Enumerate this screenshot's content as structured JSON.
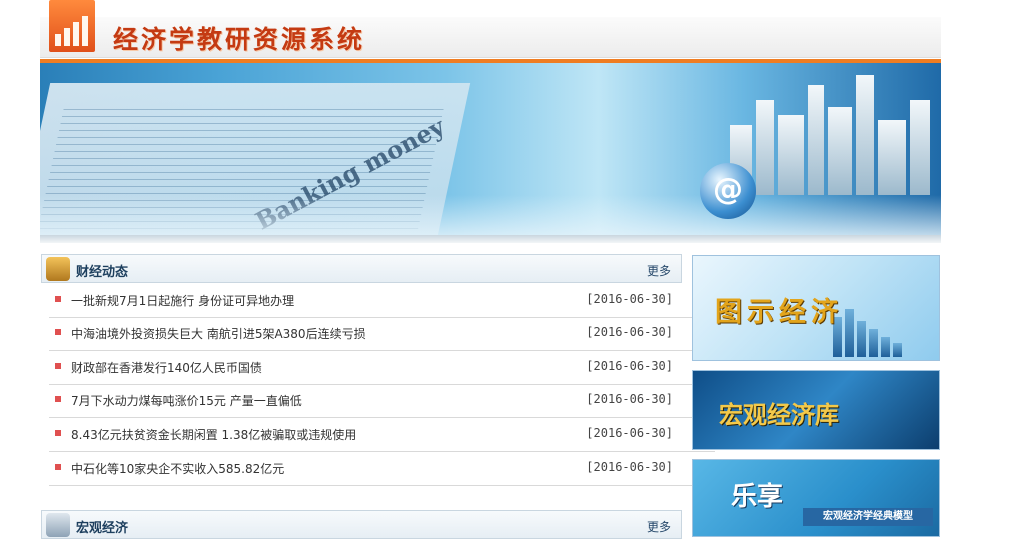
{
  "site": {
    "title": "经济学教研资源系统"
  },
  "news_panel": {
    "title": "财经动态",
    "more": "更多",
    "items": [
      {
        "title": "一批新规7月1日起施行 身份证可异地办理",
        "date": "[2016-06-30]"
      },
      {
        "title": "中海油境外投资损失巨大 南航引进5架A380后连续亏损",
        "date": "[2016-06-30]"
      },
      {
        "title": "财政部在香港发行140亿人民币国债",
        "date": "[2016-06-30]"
      },
      {
        "title": "7月下水动力煤每吨涨价15元 产量一直偏低",
        "date": "[2016-06-30]"
      },
      {
        "title": "8.43亿元扶贫资金长期闲置 1.38亿被骗取或违规使用",
        "date": "[2016-06-30]"
      },
      {
        "title": "中石化等10家央企不实收入585.82亿元",
        "date": "[2016-06-30]"
      }
    ]
  },
  "macro_panel": {
    "title": "宏观经济",
    "more": "更多"
  },
  "side_cards": {
    "card1": "图示经济",
    "card2": "宏观经济库",
    "card3": "乐享",
    "card3_sub": "宏观经济学经典模型"
  },
  "banner": {
    "text": "Banking money"
  },
  "colors": {
    "accent": "#ef7d22",
    "title": "#c43a12",
    "bullet": "#e05050"
  }
}
